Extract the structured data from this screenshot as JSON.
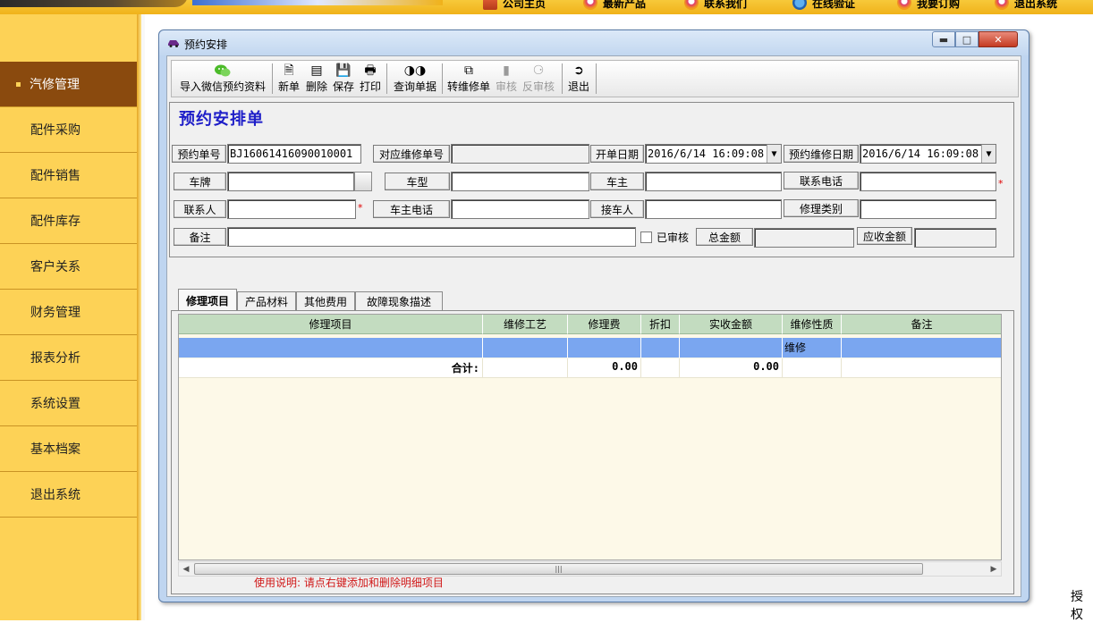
{
  "top_nav": {
    "items": [
      {
        "label": "公司主页",
        "icon": "home-icon"
      },
      {
        "label": "最新产品",
        "icon": "products-icon"
      },
      {
        "label": "联系我们",
        "icon": "contact-icon"
      },
      {
        "label": "在线验证",
        "icon": "verify-icon"
      },
      {
        "label": "我要订购",
        "icon": "order-icon"
      },
      {
        "label": "退出系统",
        "icon": "exit-icon"
      }
    ]
  },
  "sidebar": {
    "items": [
      {
        "label": "汽修管理",
        "active": true
      },
      {
        "label": "配件采购"
      },
      {
        "label": "配件销售"
      },
      {
        "label": "配件库存"
      },
      {
        "label": "客户关系"
      },
      {
        "label": "财务管理"
      },
      {
        "label": "报表分析"
      },
      {
        "label": "系统设置"
      },
      {
        "label": "基本档案"
      },
      {
        "label": "退出系统"
      }
    ]
  },
  "window": {
    "title": "预约安排",
    "toolbar": {
      "import_wechat": "导入微信预约资料",
      "new": "新单",
      "delete": "删除",
      "save": "保存",
      "print": "打印",
      "query": "查询单据",
      "to_repair": "转维修单",
      "approve": "审核",
      "unapprove": "反审核",
      "exit": "退出"
    },
    "form": {
      "heading": "预约安排单",
      "booking_no_label": "预约单号",
      "booking_no_value": "BJ16061416090010001",
      "repair_no_label": "对应维修单号",
      "repair_no_value": "",
      "open_date_label": "开单日期",
      "open_date_value": "2016/6/14 16:09:08",
      "booking_date_label": "预约维修日期",
      "booking_date_value": "2016/6/14 16:09:08",
      "plate_label": "车牌",
      "plate_value": "",
      "model_label": "车型",
      "model_value": "",
      "owner_label": "车主",
      "owner_value": "",
      "phone_label": "联系电话",
      "phone_value": "",
      "contact_label": "联系人",
      "contact_value": "",
      "owner_phone_label": "车主电话",
      "owner_phone_value": "",
      "receiver_label": "接车人",
      "receiver_value": "",
      "repair_type_label": "修理类别",
      "repair_type_value": "",
      "remark_label": "备注",
      "remark_value": "",
      "approved_label": "已审核",
      "total_amount_label": "总金额",
      "total_amount_value": "",
      "receivable_label": "应收金额",
      "receivable_value": ""
    },
    "tabs": [
      "修理项目",
      "产品材料",
      "其他费用",
      "故障现象描述"
    ],
    "grid": {
      "columns": [
        "修理项目",
        "维修工艺",
        "修理费",
        "折扣",
        "实收金额",
        "维修性质",
        "备注"
      ],
      "rows": [
        {
          "item": "",
          "process": "",
          "fee": "",
          "discount": "",
          "received": "",
          "nature": "维修",
          "remark": ""
        }
      ],
      "totals": {
        "label": "合计:",
        "fee": "0.00",
        "received": "0.00"
      }
    },
    "usage_note": "使用说明:  请点右键添加和删除明细项目"
  },
  "footer_right_text": "授权"
}
